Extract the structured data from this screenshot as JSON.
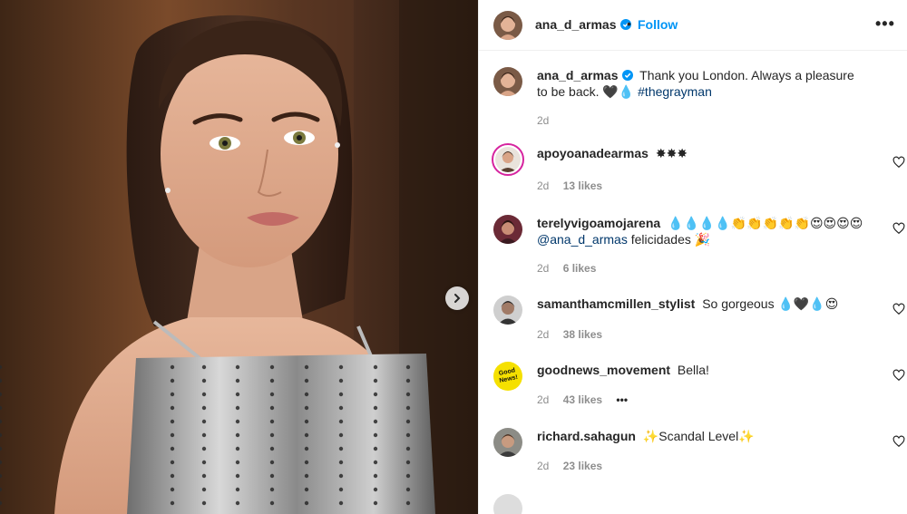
{
  "post": {
    "username": "ana_d_armas",
    "follow_label": "Follow",
    "more_label": "•••",
    "dot": "•",
    "caption": {
      "username": "ana_d_armas",
      "text": "Thank you London. Always a pleasure to be back. 🖤💧",
      "hashtag": "#thegrayman",
      "time": "2d"
    }
  },
  "comments": [
    {
      "username": "apoyoanadearmas",
      "text": "✸✸✸",
      "time": "2d",
      "likes": "13 likes"
    },
    {
      "username": "terelyvigoamojarena",
      "text": "💧💧💧💧👏👏👏👏👏😍😍😍😍",
      "mention": "@ana_d_armas",
      "text2": "felicidades 🎉",
      "time": "2d",
      "likes": "6 likes"
    },
    {
      "username": "samanthamcmillen_stylist",
      "text": "So gorgeous 💧🖤💧😍",
      "time": "2d",
      "likes": "38 likes"
    },
    {
      "username": "goodnews_movement",
      "text": "Bella!",
      "time": "2d",
      "likes": "43 likes",
      "options": "•••",
      "avatar_text": "Good News!"
    },
    {
      "username": "richard.sahagun",
      "text": "✨Scandal Level✨",
      "time": "2d",
      "likes": "23 likes"
    }
  ],
  "colors": {
    "accent": "#0095f6",
    "verified": "#0095f6",
    "muted": "#8e8e8e",
    "story_ring": "#d6249f"
  },
  "icons": [
    "verified-badge-icon",
    "more-options-icon",
    "heart-icon",
    "chevron-right-icon"
  ]
}
